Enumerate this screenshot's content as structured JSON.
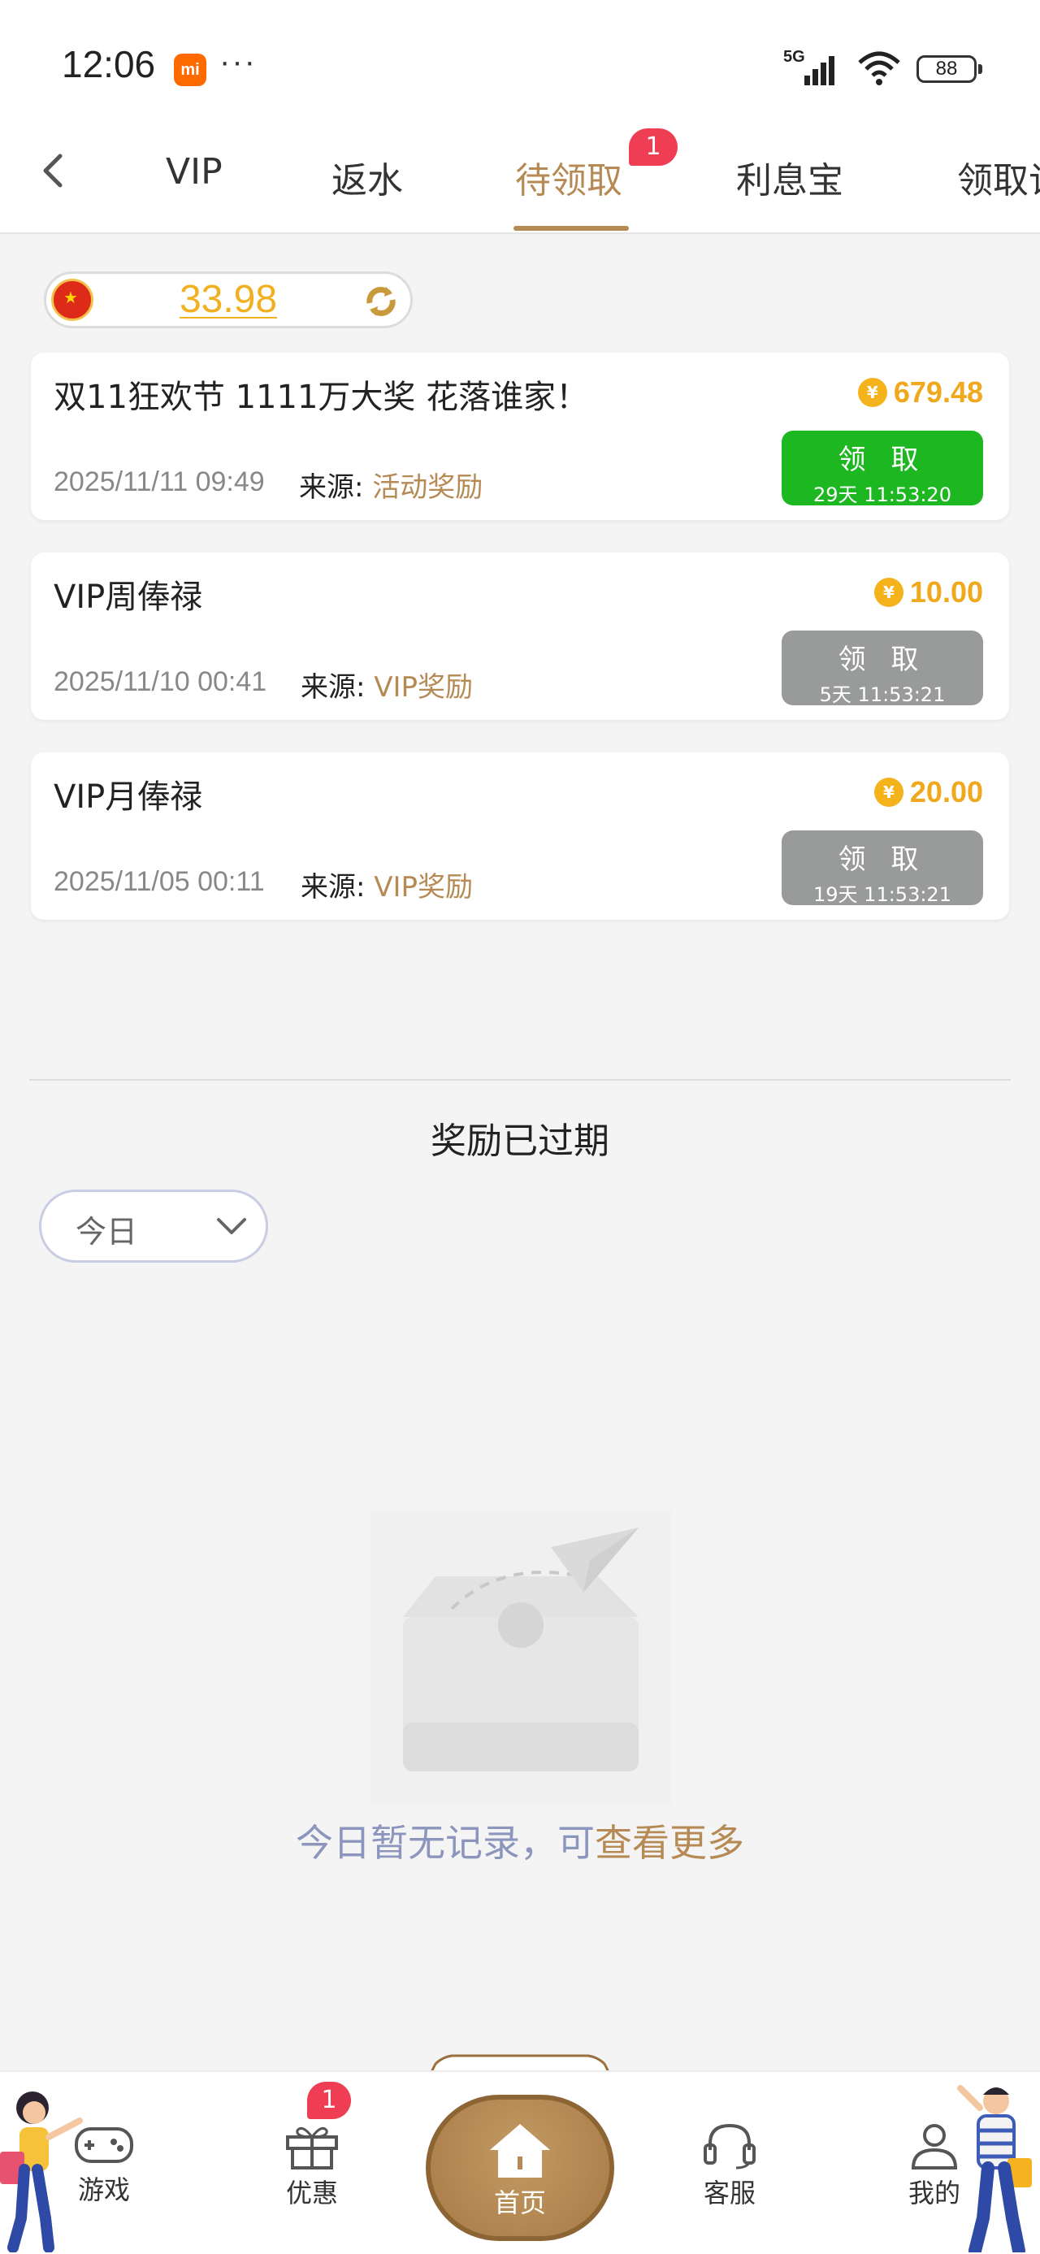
{
  "status_bar": {
    "time": "12:06",
    "mi_badge": "mi",
    "more_dots": "···",
    "network": "5G",
    "battery": "88"
  },
  "top_nav": {
    "tabs": [
      {
        "label": "VIP"
      },
      {
        "label": "返水"
      },
      {
        "label": "待领取",
        "badge": "1",
        "active": true
      },
      {
        "label": "利息宝"
      },
      {
        "label": "领取记录"
      }
    ]
  },
  "balance": {
    "value": "33.98"
  },
  "rewards": [
    {
      "title": "双11狂欢节 1111万大奖 花落谁家！",
      "amount": "679.48",
      "date": "2025/11/11 09:49",
      "source_label": "来源: ",
      "source_value": "活动奖励",
      "claim_label": "领 取",
      "countdown": "29天 11:53:20",
      "claimable": true
    },
    {
      "title": "VIP周俸禄",
      "amount": "10.00",
      "date": "2025/11/10 00:41",
      "source_label": "来源: ",
      "source_value": "VIP奖励",
      "claim_label": "领 取",
      "countdown": "5天 11:53:21",
      "claimable": false
    },
    {
      "title": "VIP月俸禄",
      "amount": "20.00",
      "date": "2025/11/05 00:11",
      "source_label": "来源: ",
      "source_value": "VIP奖励",
      "claim_label": "领 取",
      "countdown": "19天 11:53:21",
      "claimable": false
    }
  ],
  "expired": {
    "title": "奖励已过期",
    "date_filter": "今日",
    "empty_text": "今日暂无记录，可",
    "empty_link": "查看更多"
  },
  "bottom_nav": {
    "games": "游戏",
    "promotions": "优惠",
    "promotions_badge": "1",
    "home": "首页",
    "service": "客服",
    "mine": "我的"
  },
  "colors": {
    "accent_gold": "#b68a55",
    "amount_orange": "#f0a81c",
    "claim_green": "#1db722",
    "claim_gray": "#999a9a",
    "badge_red": "#ef3e54"
  }
}
